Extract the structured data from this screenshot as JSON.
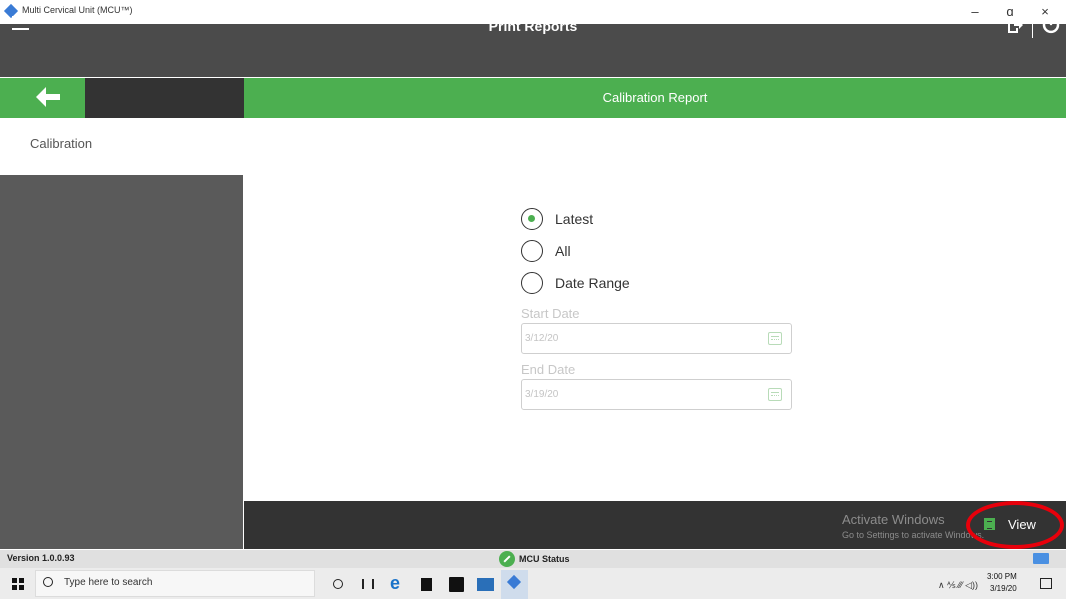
{
  "window": {
    "title": "Multi Cervical Unit (MCU™)",
    "minimize": "–",
    "restore": "ɑ",
    "close": "×"
  },
  "header": {
    "title": "Print Reports"
  },
  "subheader": {
    "title": "Calibration Report"
  },
  "sidebar": {
    "item_label": "Calibration"
  },
  "form": {
    "options": [
      {
        "label": "Latest",
        "selected": true
      },
      {
        "label": "All",
        "selected": false
      },
      {
        "label": "Date Range",
        "selected": false
      }
    ],
    "start_date": {
      "label": "Start Date",
      "value": "3/12/20"
    },
    "end_date": {
      "label": "End Date",
      "value": "3/19/20"
    }
  },
  "footer": {
    "watermark_line1": "Activate Windows",
    "watermark_line2": "Go to Settings to activate Windows.",
    "view_label": "View"
  },
  "statusbar": {
    "version": "Version 1.0.0.93",
    "mcu_status": "MCU Status"
  },
  "taskbar": {
    "search_placeholder": "Type here to search",
    "tray": "∧ ⅍ ⁄⁄⁄ ◁))",
    "time": "3:00 PM",
    "date": "3/19/20"
  },
  "colors": {
    "accent_green": "#4caf50",
    "header_dark": "#4b4b4b",
    "highlight_red": "#e8000b"
  }
}
